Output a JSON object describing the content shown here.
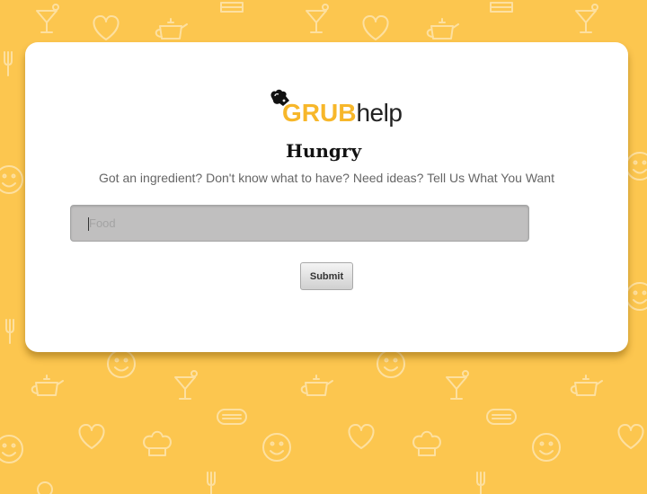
{
  "brand": {
    "logo_primary": "GRUB",
    "logo_secondary": "help",
    "mascot_icon": "chef-hat-mascot-icon"
  },
  "hero": {
    "title": "Hungry",
    "tagline": "Got an ingredient? Don't know what to have? Need ideas? Tell Us What You Want"
  },
  "search": {
    "value": "",
    "placeholder": "Food"
  },
  "actions": {
    "submit_label": "Submit"
  },
  "background": {
    "pattern_icons": [
      "cocktail-icon",
      "heart-icon",
      "teapot-icon",
      "fork-knife-icon",
      "smiley-icon",
      "hotdog-icon",
      "chef-hat-icon",
      "cake-icon"
    ]
  },
  "colors": {
    "background": "#fcc64f",
    "card": "#ffffff",
    "brand_yellow": "#f7b72a",
    "pattern": "#fde3a1",
    "input_bg": "#c0bfbf"
  }
}
